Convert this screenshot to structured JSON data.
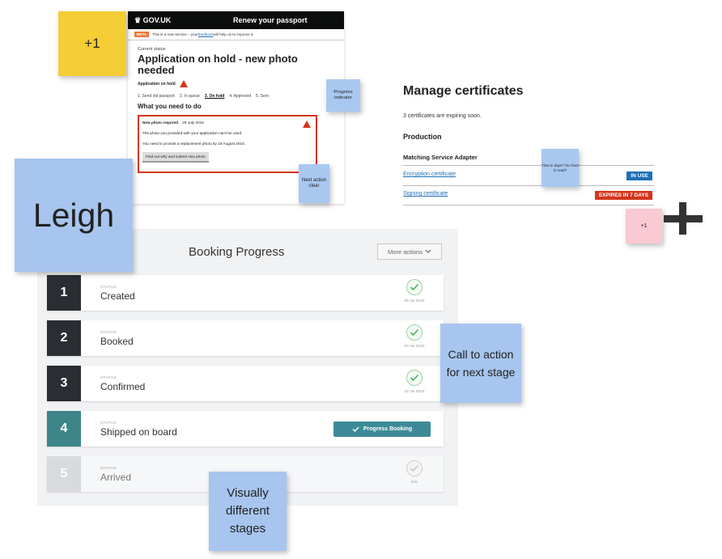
{
  "gov": {
    "logo": "♛ GOV.UK",
    "service": "Renew your passport",
    "beta_tag": "BETA",
    "beta_text_before": "This is a new service – your ",
    "beta_link": "feedback",
    "beta_text_after": " will help us to improve it.",
    "caption": "Current status",
    "heading": "Application on hold - new photo needed",
    "sub_status": "Application on hold",
    "steps": [
      "1. Send old passport",
      "2. In queue",
      "3. On hold",
      "4. Approved",
      "5. Sent"
    ],
    "current_step_index": 2,
    "section_heading": "What you need to do",
    "alert_title": "New photo required",
    "alert_date": "29 July 2016",
    "alert_line1": "The photo you provided with your application can't be used.",
    "alert_line2": "You need to provide a replacement photo by 19 August 2016.",
    "alert_button": "Find out why and submit new photo"
  },
  "certificates": {
    "title": "Manage certificates",
    "summary": "3 certificates are expiring soon.",
    "environment": "Production",
    "adapter": "Matching Service Adapter",
    "items": [
      {
        "label": "Encryption certificate",
        "status": "IN USE"
      },
      {
        "label": "Signing certificate",
        "status": "EXPIRES IN 7 DAYS"
      }
    ]
  },
  "booking": {
    "title": "Booking Progress",
    "more_actions": "More actions",
    "status_caption": "STATUS",
    "stages": [
      {
        "number": "1",
        "label": "Created",
        "date": "09 Jul 2020"
      },
      {
        "number": "2",
        "label": "Booked",
        "date": "09 Jul 2020"
      },
      {
        "number": "3",
        "label": "Confirmed",
        "date": "22 Jul 2020"
      },
      {
        "number": "4",
        "label": "Shipped on board",
        "action": "Progress Booking"
      },
      {
        "number": "5",
        "label": "Arrived",
        "date": "N/A"
      }
    ]
  },
  "stickies": {
    "plus_one_yellow": "+1",
    "progress_indicator": "Progress indicator",
    "next_action": "Next action clear",
    "leigh": "Leigh",
    "days_note": "Time in days? Too hard to read?",
    "plus_one_pink": "+1",
    "call_to_action": "Call to action for next stage",
    "visually_different": "Visually different stages"
  },
  "colors": {
    "gov_red": "#d4351c",
    "gov_blue": "#1d70b8",
    "stage_dark": "#2a2d32",
    "stage_active": "#3d8588",
    "sticky_blue": "#a7c5ee",
    "sticky_yellow": "#f5cd34",
    "sticky_pink": "#f9c9d4"
  },
  "icons": {
    "check": "check-circle-icon",
    "warning": "warning-triangle-icon",
    "chevron": "chevron-down-icon",
    "plus": "plus-icon",
    "crown": "crown-icon"
  }
}
